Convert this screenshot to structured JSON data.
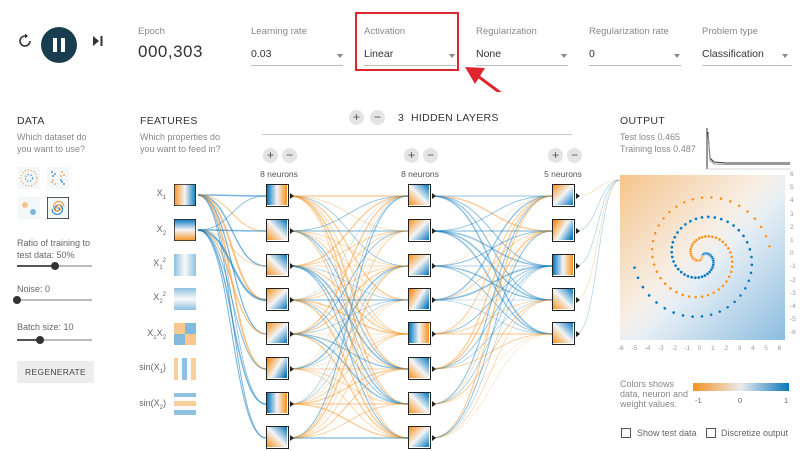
{
  "controls": {
    "reset_icon": "reset-icon",
    "play_icon": "pause-icon",
    "step_icon": "step-forward-icon",
    "epoch_label": "Epoch",
    "epoch_value": "000,303",
    "learning_rate": {
      "label": "Learning rate",
      "value": "0.03"
    },
    "activation": {
      "label": "Activation",
      "value": "Linear"
    },
    "regularization": {
      "label": "Regularization",
      "value": "None"
    },
    "regularization_rate": {
      "label": "Regularization rate",
      "value": "0"
    },
    "problem_type": {
      "label": "Problem type",
      "value": "Classification"
    }
  },
  "data_panel": {
    "title": "DATA",
    "question_line1": "Which dataset do",
    "question_line2": "you want to use?",
    "ratio_label_line1": "Ratio of training to",
    "ratio_label_line2": "test data: ",
    "ratio_value": "50%",
    "ratio_fraction": 0.5,
    "noise_label": "Noise: ",
    "noise_value": "0",
    "noise_fraction": 0.0,
    "batch_label": "Batch size: ",
    "batch_value": "10",
    "batch_fraction": 0.3,
    "regenerate_label": "REGENERATE"
  },
  "features_panel": {
    "title": "FEATURES",
    "question_line1": "Which properties do",
    "question_line2": "you want to feed in?",
    "features": [
      {
        "base": "X",
        "sub": "1",
        "sup": ""
      },
      {
        "base": "X",
        "sub": "2",
        "sup": ""
      },
      {
        "base": "X",
        "sub": "1",
        "sup": "2"
      },
      {
        "base": "X",
        "sub": "2",
        "sup": "2"
      },
      {
        "base": "X",
        "sub": "1",
        "sup": "",
        "base2": "X",
        "sub2": "2"
      },
      {
        "base": "sin(X",
        "sub": "1",
        "tail": ")"
      },
      {
        "base": "sin(X",
        "sub": "2",
        "tail": ")"
      }
    ]
  },
  "network": {
    "layer_count": "3",
    "layers_title": "HIDDEN LAYERS",
    "plus": "+",
    "minus": "−",
    "layer1_label": "8 neurons",
    "layer2_label": "8 neurons",
    "layer3_label": "5 neurons"
  },
  "output_panel": {
    "title": "OUTPUT",
    "test_loss": "Test loss 0.465",
    "training_loss": "Training loss 0.487",
    "x_ticks": [
      "-6",
      "-5",
      "-4",
      "-3",
      "-2",
      "-1",
      "0",
      "1",
      "2",
      "3",
      "4",
      "5",
      "6"
    ],
    "y_ticks": [
      "6",
      "5",
      "4",
      "3",
      "2",
      "1",
      "0",
      "-1",
      "-2",
      "-3",
      "-4",
      "-5",
      "-6"
    ],
    "legend_line1": "Colors shows",
    "legend_line2": "data, neuron and",
    "legend_line3": "weight values.",
    "legend_min": "-1",
    "legend_mid": "0",
    "legend_max": "1",
    "show_test_label": "Show test data",
    "discretize_label": "Discretize output"
  },
  "colors": {
    "orange": "#f59322",
    "blue": "#0877bd",
    "annotation_red": "#e0262d",
    "play_bg": "#183d4e"
  }
}
